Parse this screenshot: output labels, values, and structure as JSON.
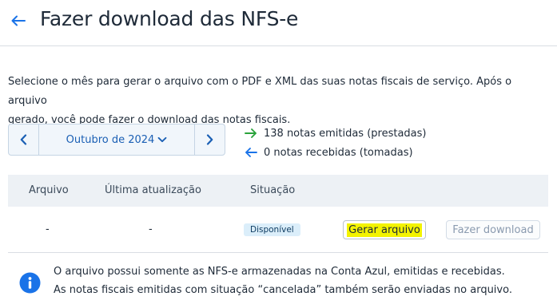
{
  "header": {
    "title": "Fazer download das NFS-e",
    "back_icon": "arrow-left-icon"
  },
  "description": {
    "line1": "Selecione o mês para gerar o arquivo com o PDF e XML das suas notas fiscais de serviço. Após o arquivo",
    "line2": "gerado, você pode fazer o download das notas fiscais."
  },
  "month_picker": {
    "selected": "Outubro de 2024",
    "prev_icon": "chevron-left-icon",
    "next_icon": "chevron-right-icon",
    "dropdown_icon": "chevron-down-icon"
  },
  "counts": {
    "issued": "138 notas emitidas (prestadas)",
    "received": "0 notas recebidas (tomadas)",
    "issued_color": "#2aa33b",
    "received_color": "#1a73e8"
  },
  "table": {
    "columns": [
      "Arquivo",
      "Última atualização",
      "Situação"
    ],
    "rows": [
      {
        "arquivo": "-",
        "ultima_atualizacao": "-",
        "situacao": "Disponível",
        "generate_label": "Gerar arquivo",
        "download_label": "Fazer download"
      }
    ]
  },
  "info": {
    "line1": "O arquivo possui somente as NFS-e armazenadas na Conta Azul, emitidas e recebidas.",
    "line2": "As notas fiscais emitidas com situação “cancelada” também serão enviadas no arquivo.",
    "icon": "info-icon",
    "icon_color": "#1a73e8"
  },
  "colors": {
    "accent": "#1a5fb4",
    "highlight": "#f3f300",
    "badge_bg": "#dbeefa"
  }
}
